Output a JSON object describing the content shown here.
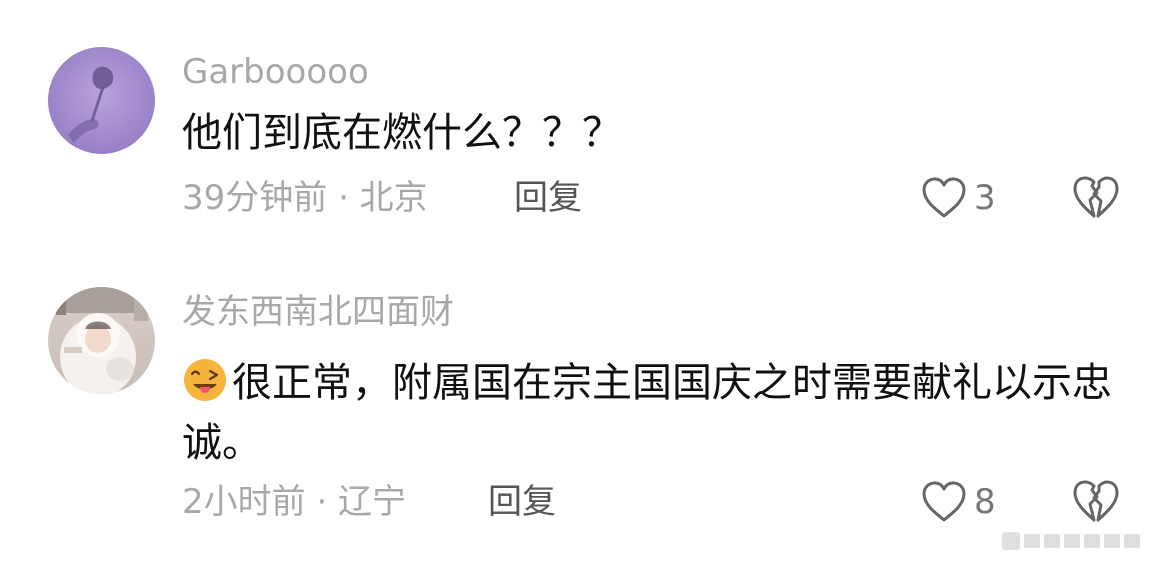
{
  "comments": [
    {
      "username": "Garbooooo",
      "text": "他们到底在燃什么？？？",
      "time_location": "39分钟前 · 北京",
      "reply_label": "回复",
      "like_count": "3",
      "like_icon": "heart-outline-icon",
      "dislike_icon": "broken-heart-icon"
    },
    {
      "username": "发东西南北四面财",
      "emoji": "winking-tongue-emoji",
      "text": "很正常，附属国在宗主国国庆之时需要献礼以示忠诚。",
      "time_location": "2小时前 · 辽宁",
      "reply_label": "回复",
      "like_count": "8",
      "like_icon": "heart-outline-icon",
      "dislike_icon": "broken-heart-icon"
    }
  ],
  "colors": {
    "username": "#a8a8a8",
    "text": "#111111",
    "meta": "#a8a8a8",
    "reply": "#555555",
    "icon": "#666666"
  }
}
